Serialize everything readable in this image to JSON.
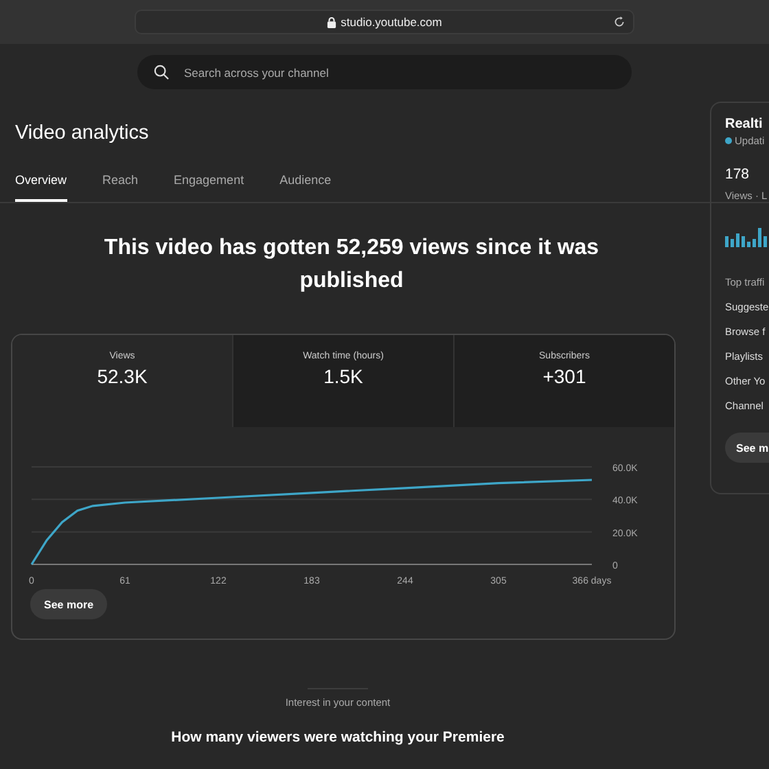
{
  "browser": {
    "url": "studio.youtube.com"
  },
  "search": {
    "placeholder": "Search across your channel"
  },
  "page": {
    "title": "Video analytics"
  },
  "tabs": [
    {
      "label": "Overview",
      "selected": true
    },
    {
      "label": "Reach",
      "selected": false
    },
    {
      "label": "Engagement",
      "selected": false
    },
    {
      "label": "Audience",
      "selected": false
    }
  ],
  "headline": "This video has gotten 52,259 views since it was published",
  "metrics": [
    {
      "label": "Views",
      "value": "52.3K",
      "selected": true
    },
    {
      "label": "Watch time (hours)",
      "value": "1.5K",
      "selected": false
    },
    {
      "label": "Subscribers",
      "value": "+301",
      "selected": false
    }
  ],
  "chart_data": {
    "type": "line",
    "x": [
      0,
      10,
      20,
      30,
      40,
      61,
      122,
      183,
      244,
      305,
      366
    ],
    "series": [
      {
        "color": "#3ea6c8",
        "values": [
          0,
          15000,
          26000,
          33000,
          36000,
          38000,
          41000,
          44000,
          47000,
          50000,
          52000
        ]
      }
    ],
    "xlim": [
      0,
      366
    ],
    "ylim": [
      0,
      60000
    ],
    "xticks": [
      0,
      61,
      122,
      183,
      244,
      305,
      {
        "value": 366,
        "label": "366 days"
      }
    ],
    "yticks": [
      0,
      {
        "value": 20000,
        "label": "20.0K"
      },
      {
        "value": 40000,
        "label": "40.0K"
      },
      {
        "value": 60000,
        "label": "60.0K"
      }
    ]
  },
  "see_more": "See more",
  "realtime": {
    "title": "Realti",
    "status": {
      "text": "Updati",
      "color": "#3ea6c8"
    },
    "count": "178",
    "count_label": "Views · L",
    "traffic_title": "Top traffi",
    "sources": [
      "Suggeste",
      "Browse f",
      "Playlists",
      "Other Yo",
      "Channel"
    ],
    "button": "See m"
  },
  "section": {
    "eyebrow": "Interest in your content",
    "title": "How many viewers were watching your Premiere"
  }
}
